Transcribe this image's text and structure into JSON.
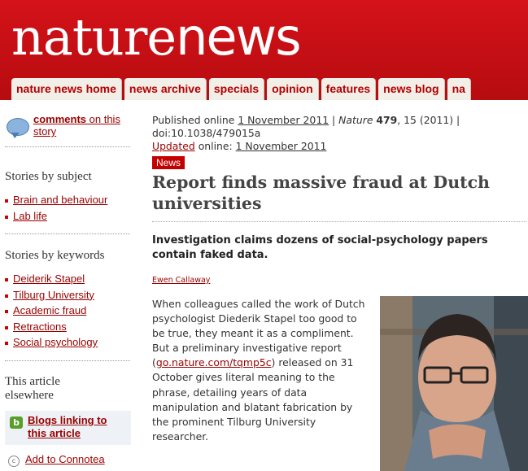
{
  "header": {
    "logo_nature": "nature",
    "logo_news": "news",
    "tabs": [
      {
        "label": "nature news home"
      },
      {
        "label": "news archive"
      },
      {
        "label": "specials"
      },
      {
        "label": "opinion"
      },
      {
        "label": "features"
      },
      {
        "label": "news blog"
      },
      {
        "label": "na"
      }
    ]
  },
  "sidebar": {
    "comments_bold": "comments",
    "comments_rest": " on this story",
    "subject_heading": "Stories by subject",
    "subjects": [
      "Brain and behaviour",
      "Lab life"
    ],
    "keywords_heading": "Stories by keywords",
    "keywords": [
      "Deiderik Stapel",
      "Tilburg University",
      "Academic fraud",
      "Retractions",
      "Social psychology"
    ],
    "elsewhere_heading": "This article elsewhere",
    "blogs_label": "Blogs linking to this article",
    "connotea_label": "Add to Connotea"
  },
  "article": {
    "published_prefix": "Published online ",
    "published_date": "1 November 2011",
    "sep1": " | ",
    "journal": "Nature",
    "volume": "479",
    "pages": ", 15 (2011) |",
    "doi": "doi:10.1038/479015a",
    "updated_label": "Updated",
    "updated_mid": " online: ",
    "updated_date": "1 November 2011",
    "badge": "News",
    "title": "Report finds massive fraud at Dutch universities",
    "standfirst": "Investigation claims dozens of social-psychology papers contain faked data.",
    "author": "Ewen Callaway",
    "body_part1": "When colleagues called the work of Dutch psychologist Diederik Stapel too good to be true, they meant it as a compliment. But a preliminary investigative report (",
    "body_link": "go.nature.com/tqmp5c",
    "body_part2": ") released on 31 October gives literal meaning to the phrase, detailing years of data manipulation and blatant fabrication by the prominent Tilburg University researcher."
  },
  "colors": {
    "header_red": "#c41016",
    "link_red": "#990000",
    "tab_bg": "#f2efe8"
  }
}
